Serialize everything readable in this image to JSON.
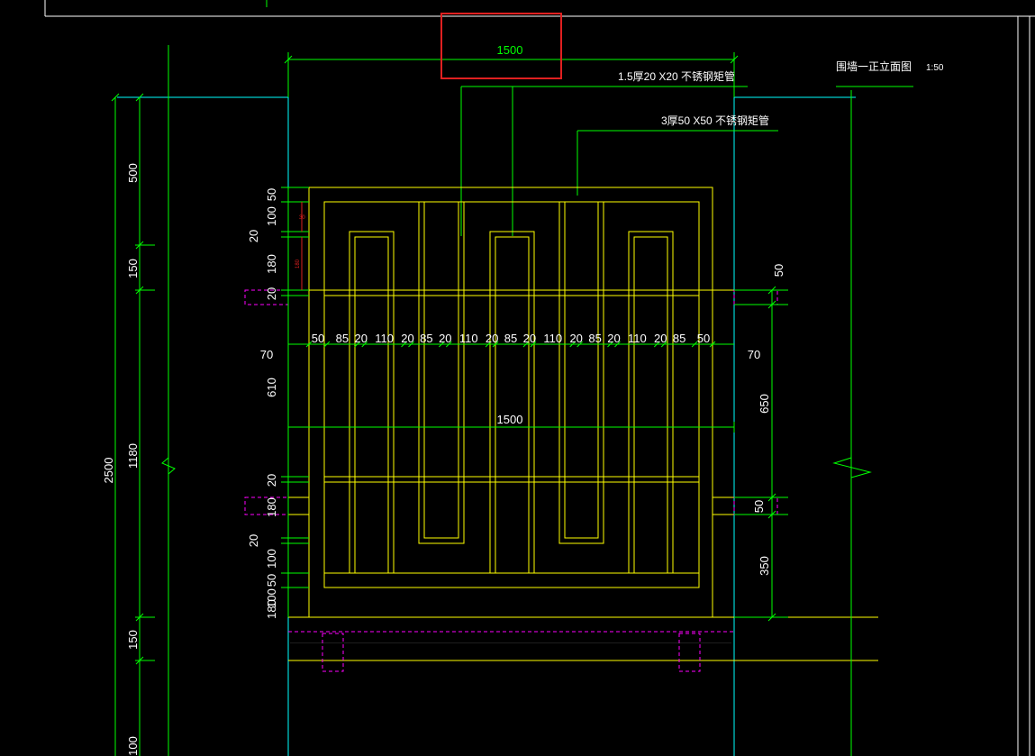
{
  "drawing": {
    "title": "围墙一正立面图",
    "scale": "1:50",
    "highlighted_dimension": "1500",
    "annotations": [
      {
        "id": "tube-small",
        "text": "1.5厚20 X20 不锈钢矩管"
      },
      {
        "id": "tube-large",
        "text": "3厚50 X50 不锈钢矩管"
      }
    ],
    "overall_height": "2500",
    "overall_width": "1500",
    "left_chain_outer": [
      "500",
      "150",
      "1180",
      "150",
      "100"
    ],
    "left_chain_inner_top": [
      "50",
      "100",
      "20",
      "180",
      "20"
    ],
    "left_chain_inner_mid": [
      "70",
      "610"
    ],
    "left_chain_inner_bottom": [
      "20",
      "180",
      "20",
      "100",
      "50",
      "100",
      "180"
    ],
    "right_chain": [
      "50",
      "70",
      "650",
      "50",
      "350"
    ],
    "horizontal_chain": [
      "50",
      "85",
      "20",
      "110",
      "20",
      "85",
      "20",
      "110",
      "20",
      "85",
      "20",
      "110",
      "20",
      "85",
      "20",
      "110",
      "20",
      "85",
      "50"
    ],
    "small_red_labels": [
      "30",
      "180"
    ]
  },
  "colors": {
    "dimension": "#00ff00",
    "outline": "#ffff00",
    "cyan": "#00ffff",
    "magenta": "#ff00ff",
    "highlight": "#e02020",
    "text": "#ffffff"
  }
}
